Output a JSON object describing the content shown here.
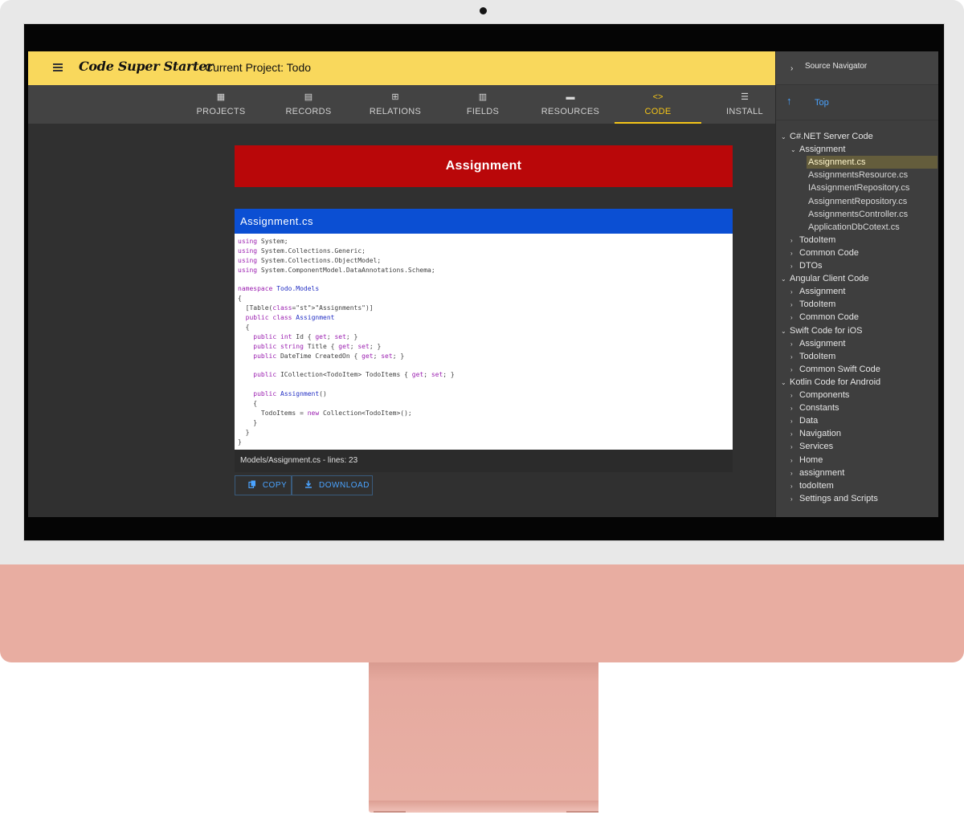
{
  "app": {
    "title": "Code Super Starter",
    "current_project": "Current Project: Todo"
  },
  "nav": {
    "tabs": [
      {
        "label": "PROJECTS",
        "icon": "grid-icon",
        "glyph": "▦"
      },
      {
        "label": "RECORDS",
        "icon": "records-icon",
        "glyph": "▤"
      },
      {
        "label": "RELATIONS",
        "icon": "relations-icon",
        "glyph": "⊞"
      },
      {
        "label": "FIELDS",
        "icon": "document-icon",
        "glyph": "▥"
      },
      {
        "label": "RESOURCES",
        "icon": "table-icon",
        "glyph": "▬"
      },
      {
        "label": "CODE",
        "icon": "code-icon",
        "glyph": "<>"
      },
      {
        "label": "INSTALL",
        "icon": "list-icon",
        "glyph": "☰"
      }
    ],
    "active_tab": "CODE"
  },
  "main": {
    "banner": "Assignment",
    "code_file": "Assignment.cs",
    "code_lines": [
      [
        "using",
        " System;"
      ],
      [
        "using",
        " System.Collections.Generic;"
      ],
      [
        "using",
        " System.Collections.ObjectModel;"
      ],
      [
        "using",
        " System.ComponentModel.DataAnnotations.Schema;"
      ],
      [
        "",
        ""
      ],
      [
        "namespace",
        " Todo.Models"
      ],
      [
        "",
        "{"
      ],
      [
        "",
        "  [Table(\"Assignments\")]"
      ],
      [
        "",
        "  public class Assignment"
      ],
      [
        "",
        "  {"
      ],
      [
        "",
        "    public int Id { get; set; }"
      ],
      [
        "",
        "    public string Title { get; set; }"
      ],
      [
        "",
        "    public DateTime CreatedOn { get; set; }"
      ],
      [
        "",
        ""
      ],
      [
        "",
        "    public ICollection<TodoItem> TodoItems { get; set; }"
      ],
      [
        "",
        ""
      ],
      [
        "",
        "    public Assignment()"
      ],
      [
        "",
        "    {"
      ],
      [
        "",
        "      TodoItems = new Collection<TodoItem>();"
      ],
      [
        "",
        "    }"
      ],
      [
        "",
        "  }"
      ],
      [
        "",
        "}"
      ]
    ],
    "footer": "Models/Assignment.cs - lines: 23",
    "copy_label": "COPY",
    "download_label": "DOWNLOAD"
  },
  "navigator": {
    "title": "Source Navigator",
    "top_label": "Top",
    "tree": [
      {
        "label": "C#.NET Server Code",
        "level": 0,
        "expanded": true
      },
      {
        "label": "Assignment",
        "level": 1,
        "expanded": true
      },
      {
        "label": "Assignment.cs",
        "level": 2,
        "file": true,
        "selected": true
      },
      {
        "label": "AssignmentsResource.cs",
        "level": 2,
        "file": true
      },
      {
        "label": "IAssignmentRepository.cs",
        "level": 2,
        "file": true
      },
      {
        "label": "AssignmentRepository.cs",
        "level": 2,
        "file": true
      },
      {
        "label": "AssignmentsController.cs",
        "level": 2,
        "file": true
      },
      {
        "label": "ApplicationDbCotext.cs",
        "level": 2,
        "file": true
      },
      {
        "label": "TodoItem",
        "level": 1,
        "expanded": false
      },
      {
        "label": "Common Code",
        "level": 1,
        "expanded": false
      },
      {
        "label": "DTOs",
        "level": 1,
        "expanded": false
      },
      {
        "label": "Angular Client Code",
        "level": 0,
        "expanded": true
      },
      {
        "label": "Assignment",
        "level": 1,
        "expanded": false
      },
      {
        "label": "TodoItem",
        "level": 1,
        "expanded": false
      },
      {
        "label": "Common Code",
        "level": 1,
        "expanded": false
      },
      {
        "label": "Swift Code for iOS",
        "level": 0,
        "expanded": true
      },
      {
        "label": "Assignment",
        "level": 1,
        "expanded": false
      },
      {
        "label": "TodoItem",
        "level": 1,
        "expanded": false
      },
      {
        "label": "Common Swift Code",
        "level": 1,
        "expanded": false
      },
      {
        "label": "Kotlin Code for Android",
        "level": 0,
        "expanded": true
      },
      {
        "label": "Components",
        "level": 1,
        "expanded": false
      },
      {
        "label": "Constants",
        "level": 1,
        "expanded": false
      },
      {
        "label": "Data",
        "level": 1,
        "expanded": false
      },
      {
        "label": "Navigation",
        "level": 1,
        "expanded": false
      },
      {
        "label": "Services",
        "level": 1,
        "expanded": false
      },
      {
        "label": "Home",
        "level": 1,
        "expanded": false
      },
      {
        "label": "assignment",
        "level": 1,
        "expanded": false
      },
      {
        "label": "todoItem",
        "level": 1,
        "expanded": false
      },
      {
        "label": "Settings and Scripts",
        "level": 1,
        "expanded": false
      }
    ]
  },
  "colors": {
    "topbar": "#f9d85c",
    "banner": "#b90709",
    "code_header": "#0b4fd3",
    "active_tab": "#f5c518",
    "link": "#4aa3ff"
  }
}
